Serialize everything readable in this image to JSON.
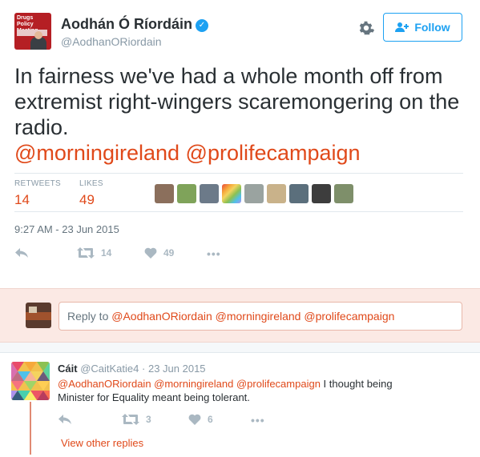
{
  "tweet": {
    "avatar_text": "Drugs Policy Meeting",
    "author_name": "Aodhán Ó Ríordáin",
    "verified_glyph": "✓",
    "handle": "@AodhanORiordain",
    "follow_label": "Follow",
    "text_lines": [
      "In fairness we've had a whole month off from",
      "extremist right-wingers scaremongering on the",
      "radio."
    ],
    "mention_1": "@morningireland",
    "mention_2": "@prolifecampaign",
    "retweets_label": "RETWEETS",
    "retweets_count": "14",
    "likes_label": "LIKES",
    "likes_count": "49",
    "timestamp": "9:27 AM - 23 Jun 2015",
    "actions": {
      "retweet_count": "14",
      "like_count": "49",
      "more_glyph": "•••"
    },
    "likers": [
      "#8b6f5c",
      "#7fa35a",
      "#6c7a89",
      "rainbow",
      "#9aa3a0",
      "#c9b28a",
      "#5b6f7c",
      "#3d3d3d",
      "#7e8f6a"
    ]
  },
  "reply_composer": {
    "prefix": "Reply to ",
    "mentions": "@AodhanORiordain @morningireland @prolifecampaign"
  },
  "reply": {
    "name": "Cáit",
    "handle": "@CaitKatie4",
    "date": "23 Jun 2015",
    "mentions": "@AodhanORiordain @morningireland @prolifecampaign",
    "text_tail": " I thought being",
    "text_line2": "Minister for Equality meant being tolerant.",
    "retweet_count": "3",
    "like_count": "6",
    "more_glyph": "•••",
    "view_other_replies": "View other replies"
  },
  "colors": {
    "accent": "#e0491a",
    "follow_blue": "#1da1f2",
    "muted": "#8899a6",
    "icon": "#aab8c2",
    "reply_band": "#fbe9e4"
  },
  "icons": [
    "verified-icon",
    "gear-icon",
    "follow-person-icon",
    "reply-icon",
    "retweet-icon",
    "heart-icon",
    "more-icon"
  ]
}
